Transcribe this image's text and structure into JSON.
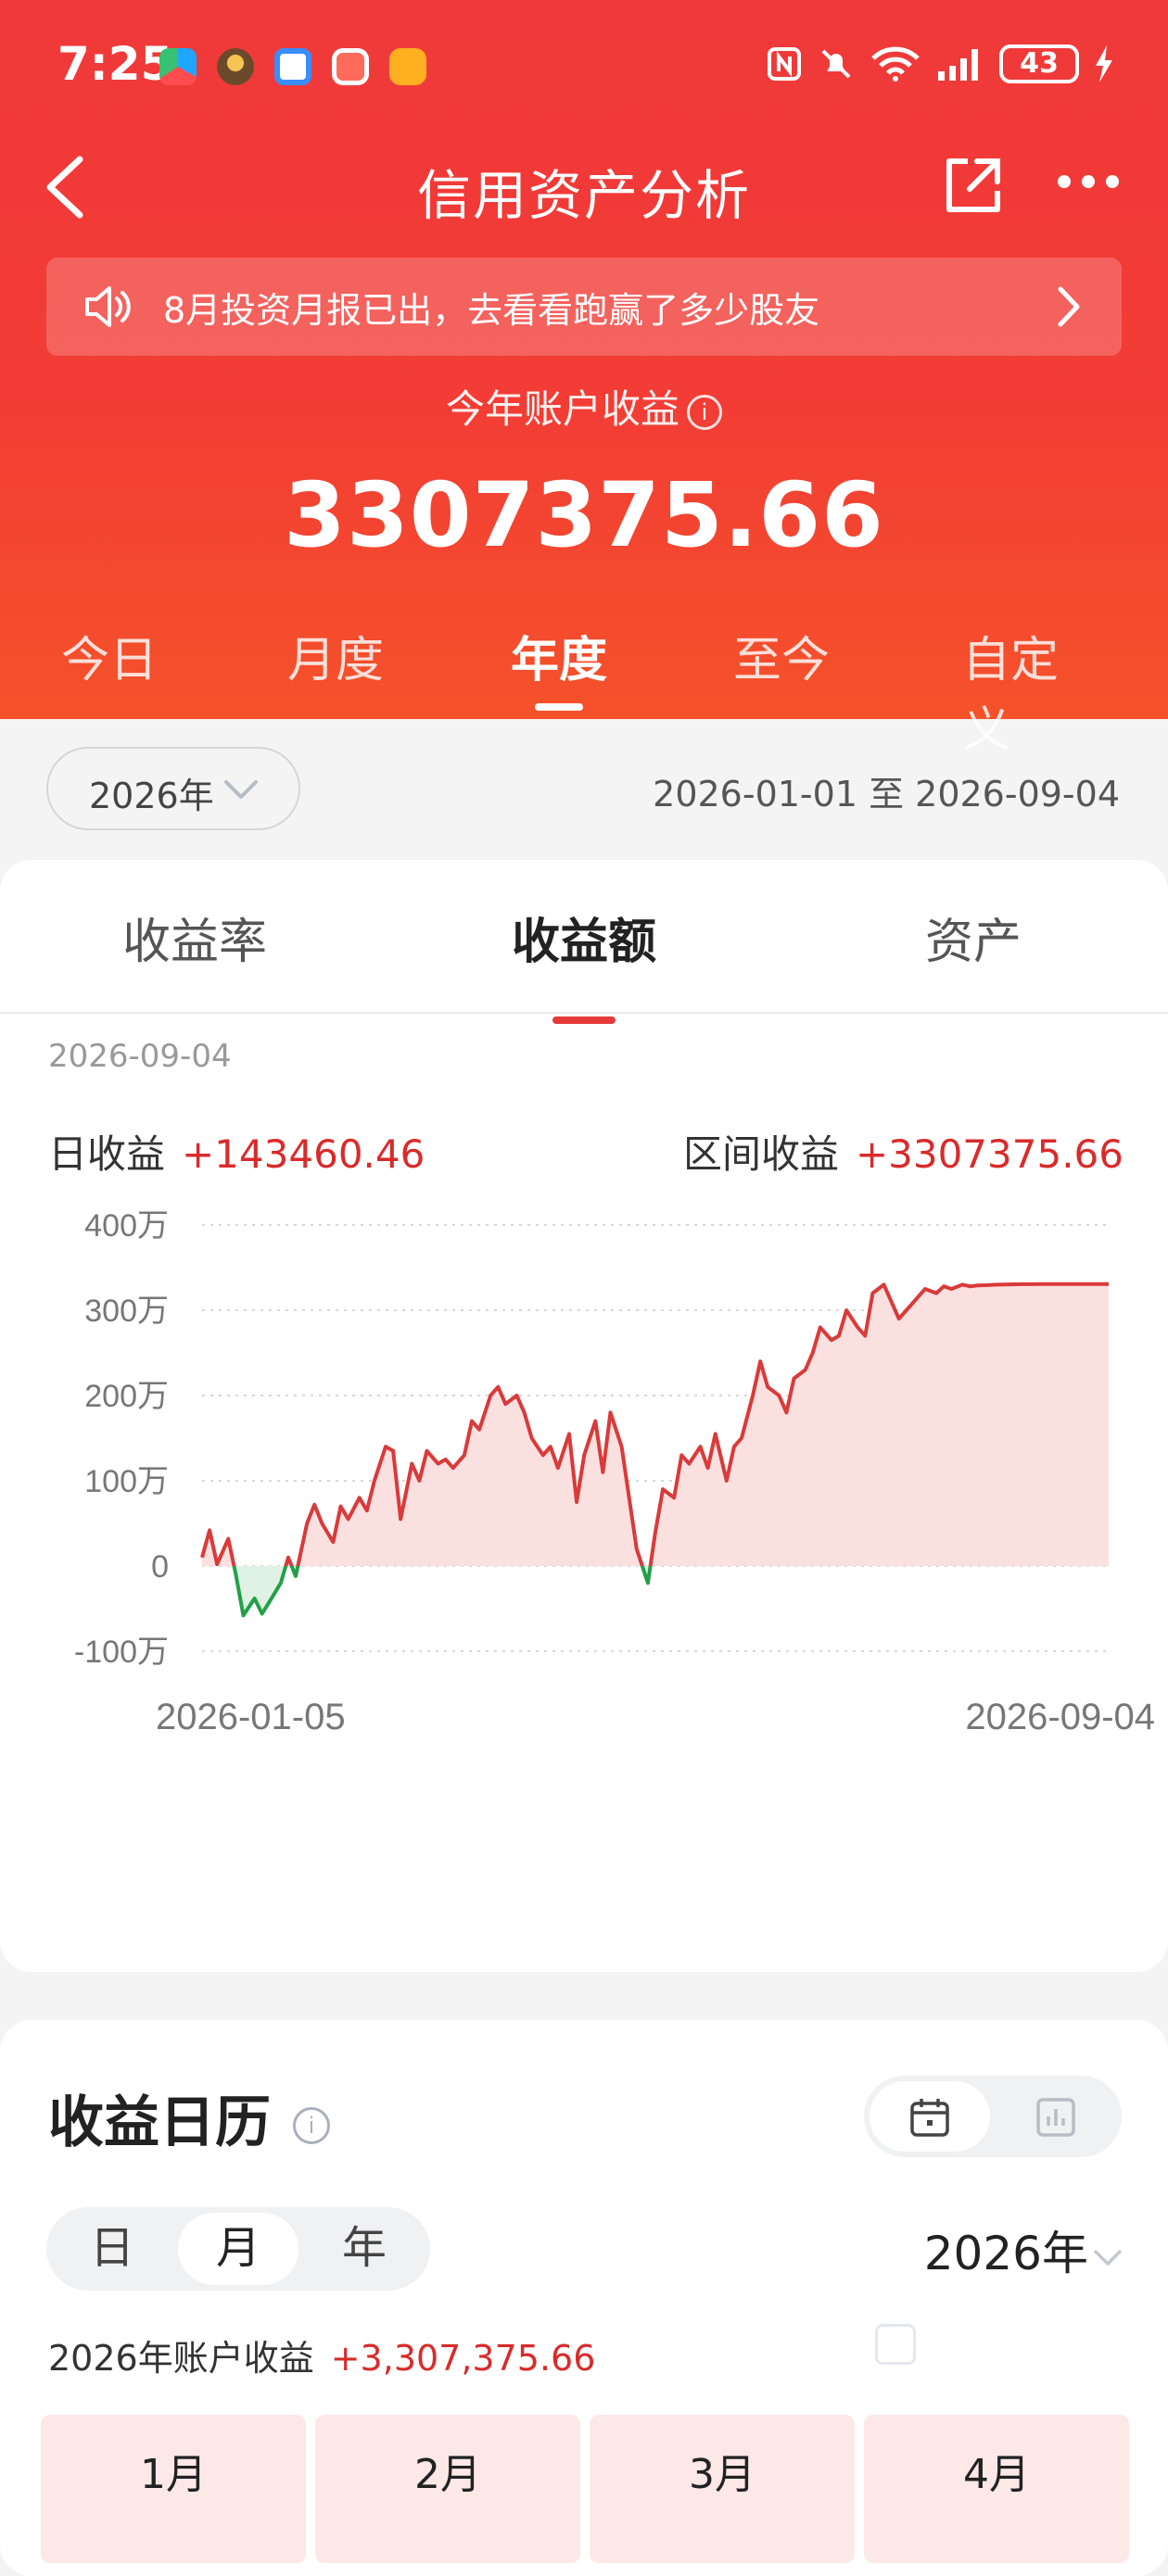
{
  "status": {
    "time": "7:25",
    "battery": "43",
    "app_icons": [
      "app-icon-1",
      "app-icon-2",
      "app-icon-3",
      "app-icon-4",
      "app-icon-5"
    ],
    "sys_icons": [
      "nfc-icon",
      "mute-icon",
      "wifi-icon",
      "signal-icon",
      "battery-icon",
      "charging-icon"
    ]
  },
  "nav": {
    "title": "信用资产分析"
  },
  "notice": {
    "text": "8月投资月报已出，去看看跑赢了多少股友"
  },
  "summary": {
    "label": "今年账户收益",
    "value": "3307375.66"
  },
  "period_tabs": [
    {
      "label": "今日",
      "active": false
    },
    {
      "label": "月度",
      "active": false
    },
    {
      "label": "年度",
      "active": true
    },
    {
      "label": "至今",
      "active": false
    },
    {
      "label": "自定义",
      "active": false
    }
  ],
  "filter": {
    "year": "2026年",
    "date_range": "2026-01-01 至 2026-09-04"
  },
  "metric_tabs": [
    {
      "label": "收益率",
      "active": false
    },
    {
      "label": "收益额",
      "active": true
    },
    {
      "label": "资产",
      "active": false
    }
  ],
  "detail": {
    "date": "2026-09-04",
    "daily_label": "日收益",
    "daily_value": "+143460.46",
    "range_label": "区间收益",
    "range_value": "+3307375.66"
  },
  "chart_data": {
    "type": "area",
    "y_tick_labels": [
      "400万",
      "300万",
      "200万",
      "100万",
      "0",
      "-100万"
    ],
    "y_ticks": [
      4000000,
      3000000,
      2000000,
      1000000,
      0,
      -1000000
    ],
    "ylim": [
      -1000000,
      4000000
    ],
    "x_tick_labels": [
      "2026-01-05",
      "2026-09-04"
    ],
    "x_range": [
      "2026-01-05",
      "2026-09-04"
    ],
    "grid": true,
    "colors": {
      "positive": "#d93a3a",
      "positive_fill": "#fbe0e0",
      "negative": "#23a047",
      "negative_fill": "#dff2e4"
    },
    "series": [
      {
        "x": [
          "2026-01-05",
          "2026-01-07",
          "2026-01-09",
          "2026-01-12",
          "2026-01-14",
          "2026-01-16",
          "2026-01-19",
          "2026-01-21",
          "2026-01-23",
          "2026-01-26",
          "2026-01-28",
          "2026-01-30",
          "2026-02-02",
          "2026-02-04",
          "2026-02-06",
          "2026-02-09",
          "2026-02-11",
          "2026-02-13",
          "2026-02-16",
          "2026-02-18",
          "2026-02-20",
          "2026-02-23",
          "2026-02-25",
          "2026-02-27",
          "2026-03-02",
          "2026-03-04",
          "2026-03-06",
          "2026-03-09",
          "2026-03-11",
          "2026-03-13",
          "2026-03-16",
          "2026-03-18",
          "2026-03-20",
          "2026-03-23",
          "2026-03-25",
          "2026-03-27",
          "2026-03-30",
          "2026-04-01",
          "2026-04-03",
          "2026-04-06",
          "2026-04-08",
          "2026-04-10",
          "2026-04-13",
          "2026-04-15",
          "2026-04-17",
          "2026-04-20",
          "2026-04-22",
          "2026-04-24",
          "2026-04-27",
          "2026-04-29",
          "2026-05-01",
          "2026-05-04",
          "2026-05-06",
          "2026-05-08",
          "2026-05-11",
          "2026-05-13",
          "2026-05-15",
          "2026-05-18",
          "2026-05-20",
          "2026-05-22",
          "2026-05-25",
          "2026-05-27",
          "2026-05-29",
          "2026-06-01",
          "2026-06-03",
          "2026-06-05",
          "2026-06-08",
          "2026-06-10",
          "2026-06-12",
          "2026-06-15",
          "2026-06-17",
          "2026-06-19",
          "2026-06-22",
          "2026-06-24",
          "2026-06-26",
          "2026-06-29",
          "2026-07-01",
          "2026-07-03",
          "2026-07-06",
          "2026-07-08",
          "2026-07-10",
          "2026-07-13",
          "2026-07-15",
          "2026-07-17",
          "2026-07-20",
          "2026-07-22",
          "2026-07-24",
          "2026-07-27",
          "2026-07-29",
          "2026-07-31",
          "2026-08-03",
          "2026-08-05",
          "2026-08-07",
          "2026-08-10",
          "2026-08-12",
          "2026-08-14",
          "2026-08-17",
          "2026-08-19",
          "2026-08-21",
          "2026-08-24",
          "2026-08-26",
          "2026-08-28",
          "2026-08-31",
          "2026-09-02",
          "2026-09-04"
        ],
        "values": [
          100000,
          420000,
          20000,
          320000,
          -100000,
          -580000,
          -380000,
          -560000,
          -420000,
          -200000,
          100000,
          -120000,
          500000,
          720000,
          500000,
          280000,
          700000,
          550000,
          800000,
          650000,
          1000000,
          1400000,
          1350000,
          550000,
          1200000,
          1000000,
          1350000,
          1200000,
          1250000,
          1150000,
          1300000,
          1700000,
          1600000,
          2000000,
          2100000,
          1900000,
          2000000,
          1800000,
          1500000,
          1300000,
          1400000,
          1150000,
          1550000,
          750000,
          1300000,
          1700000,
          1100000,
          1800000,
          1400000,
          800000,
          200000,
          -200000,
          400000,
          900000,
          800000,
          1300000,
          1200000,
          1400000,
          1150000,
          1550000,
          1000000,
          1400000,
          1500000,
          2000000,
          2400000,
          2100000,
          2000000,
          1800000,
          2200000,
          2300000,
          2500000,
          2800000,
          2650000,
          2700000,
          3000000,
          2800000,
          2700000,
          3200000,
          3300000,
          3100000,
          2900000,
          3050000,
          3150000,
          3250000,
          3200000,
          3280000,
          3250000,
          3300000,
          3280000,
          3290000,
          3295000,
          3300000,
          3302000,
          3304000,
          3305000,
          3305500,
          3306000,
          3306500,
          3306800,
          3307000,
          3307100,
          3307200,
          3307300,
          3307350,
          3307375.66
        ]
      }
    ]
  },
  "calendar": {
    "title": "收益日历",
    "modes": [
      {
        "label": "日",
        "active": false
      },
      {
        "label": "月",
        "active": true
      },
      {
        "label": "年",
        "active": false
      }
    ],
    "year": "2026年",
    "sum_label": "2026年账户收益",
    "sum_value": "+3,307,375.66",
    "months": [
      {
        "label": "1月"
      },
      {
        "label": "2月"
      },
      {
        "label": "3月"
      },
      {
        "label": "4月"
      }
    ]
  }
}
